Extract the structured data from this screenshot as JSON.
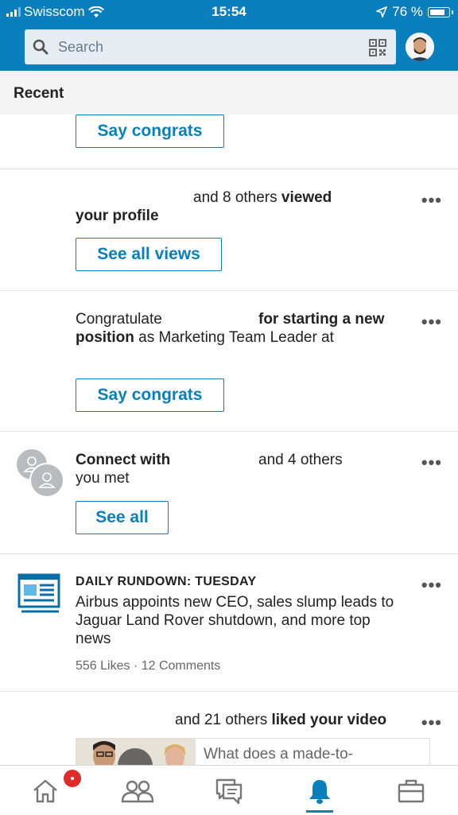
{
  "status": {
    "carrier": "Swisscom",
    "time": "15:54",
    "battery": "76 %"
  },
  "search": {
    "placeholder": "Search"
  },
  "section": {
    "title": "Recent"
  },
  "cards": {
    "c1": {
      "button": "Say congrats"
    },
    "c2": {
      "text1": "and 8 others ",
      "bold1": "viewed",
      "bold2": "your profile",
      "button": "See all views"
    },
    "c3": {
      "text1": "Congratulate",
      "bold1": "for starting a new",
      "bold2": "position",
      "text2": " as Marketing Team Leader at",
      "button": "Say congrats"
    },
    "c4": {
      "bold1": "Connect with",
      "text1": "and 4 others",
      "text2": "you met",
      "button": "See all"
    },
    "c5": {
      "kicker": "DAILY RUNDOWN: TUESDAY",
      "headline": "Airbus appoints new CEO, sales slump leads to Jaguar Land Rover shutdown, and more top news",
      "stats": "556 Likes · 12 Comments"
    },
    "c6": {
      "text1": "and 21 others ",
      "bold1": "liked your video",
      "preview": "What does a made-to-"
    }
  },
  "more_label": "•••",
  "colors": {
    "brand": "#0a7fbd",
    "badge": "#e12b2b"
  },
  "tabs": [
    {
      "name": "home-icon"
    },
    {
      "name": "my-network-icon"
    },
    {
      "name": "messaging-icon"
    },
    {
      "name": "notifications-icon",
      "active": true
    },
    {
      "name": "jobs-icon"
    }
  ]
}
